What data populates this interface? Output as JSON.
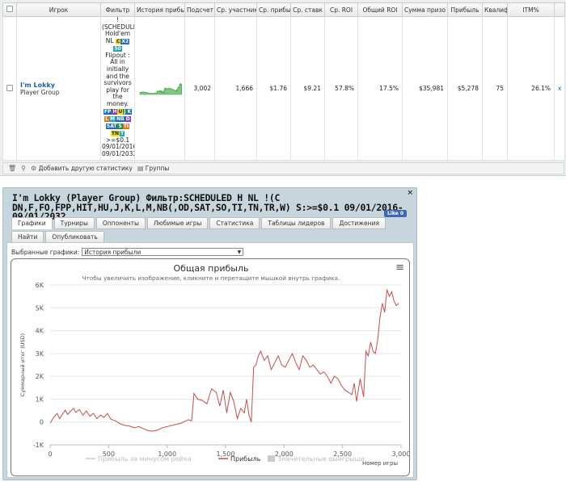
{
  "stats_table": {
    "headers": [
      "",
      "Игрок",
      "Фильтр",
      "История прибы",
      "Подсчет",
      "Ср. участник",
      "Ср. прибы",
      "Ср. ставк",
      "Ср. ROI",
      "Общий ROI",
      "Сумма призо",
      "Прибыль",
      "Квалиф",
      "ITM%",
      ""
    ],
    "row": {
      "player_name": "I'm Lokky",
      "player_group": "Player Group",
      "filter_lines_top": [
        "!",
        "(SCHEDULE",
        "Hold'em",
        "NL"
      ],
      "filter_tags1": [
        "C",
        "X2"
      ],
      "filter_tag_50": "50",
      "filter_desc": "Flipout : All in initially and the survivors play for the money.",
      "filter_tags2": [
        "FP",
        "H",
        "U",
        "J",
        "K",
        "L",
        "M",
        "NB",
        "D",
        "SAT",
        "S",
        "TI",
        "TN",
        "T"
      ],
      "filter_tail": [
        ">=$0.1",
        "09/01/2016",
        "09/01/2032"
      ],
      "count": "3,002",
      "avg_entrants": "1,666",
      "avg_profit": "$1.76",
      "avg_stake": "$9.21",
      "avg_roi": "57.8%",
      "total_roi": "17.5%",
      "prize_sum": "$35,981",
      "profit": "$5,278",
      "qualified": "75",
      "itm": "26.1%",
      "remove_link": "x"
    },
    "toolbar": {
      "add_stats": "Добавить другую статистику",
      "groups": "Группы"
    }
  },
  "panel": {
    "title": "I'm Lokky (Player Group) Фильтр:SCHEDULED H NL !(C DN,F,FO,FPP,HIT,HU,J,K,L,M,NB(,OD,SAT,SO,TI,TN,TR,W) S:>=$0.1 09/01/2016-09/01/2032",
    "like_label": "Like 0",
    "close": "×",
    "tabs": [
      "Графики",
      "Турниры",
      "Оппоненты",
      "Любимые игры",
      "Статистика",
      "Таблицы лидеров",
      "Достижения",
      "Найти",
      "Опубликовать"
    ],
    "active_tab": "Графики",
    "selected_label": "Выбранные графики:",
    "selected_value": "История прибыли"
  },
  "chart_data": {
    "type": "line",
    "title": "Общая прибыль",
    "subtitle": "Чтобы увеличить изображение, кликните и перетащите мышкой внутрь графика.",
    "ylabel": "Суммарный итог (USD)",
    "xlabel": "Номер игры",
    "xlim": [
      0,
      3000
    ],
    "ylim": [
      -1000,
      6000
    ],
    "x_ticks": [
      "0",
      "500",
      "1,000",
      "1,500",
      "2,000",
      "2,500",
      "3,000"
    ],
    "y_ticks": [
      "-1K",
      "0",
      "1K",
      "2K",
      "3K",
      "4K",
      "5K",
      "6K"
    ],
    "grid": true,
    "legend": [
      "Прибыль за минусом рейка",
      "Прибыль",
      "Значительные выигрыши"
    ],
    "legend_position": "bottom",
    "series": [
      {
        "name": "Прибыль",
        "color": "#c0504d",
        "x": [
          0,
          30,
          60,
          80,
          100,
          130,
          150,
          170,
          200,
          220,
          250,
          280,
          310,
          340,
          370,
          400,
          430,
          460,
          490,
          520,
          560,
          600,
          640,
          680,
          720,
          760,
          800,
          840,
          880,
          920,
          960,
          1000,
          1040,
          1080,
          1120,
          1150,
          1180,
          1210,
          1230,
          1260,
          1300,
          1340,
          1380,
          1420,
          1450,
          1480,
          1510,
          1540,
          1570,
          1600,
          1630,
          1660,
          1680,
          1700,
          1720,
          1740,
          1760,
          1780,
          1800,
          1830,
          1860,
          1890,
          1920,
          1950,
          1980,
          2010,
          2040,
          2070,
          2100,
          2130,
          2160,
          2190,
          2220,
          2250,
          2280,
          2310,
          2340,
          2370,
          2400,
          2430,
          2460,
          2490,
          2520,
          2550,
          2580,
          2600,
          2620,
          2650,
          2680,
          2700,
          2720,
          2740,
          2760,
          2780,
          2800,
          2820,
          2840,
          2860,
          2880,
          2900,
          2920,
          2940,
          2960,
          2980
        ],
        "y": [
          -50,
          200,
          380,
          150,
          300,
          520,
          330,
          450,
          600,
          420,
          550,
          300,
          480,
          250,
          380,
          150,
          300,
          200,
          380,
          120,
          50,
          -80,
          -150,
          -180,
          -250,
          -200,
          -300,
          -380,
          -400,
          -350,
          -250,
          -200,
          -150,
          -100,
          -50,
          30,
          100,
          50,
          1250,
          1000,
          950,
          800,
          1450,
          1300,
          700,
          1400,
          400,
          1300,
          900,
          150,
          600,
          400,
          1000,
          300,
          0,
          2400,
          2500,
          2900,
          3100,
          2700,
          2900,
          2300,
          2600,
          2900,
          2500,
          2400,
          2700,
          3000,
          2600,
          2300,
          2900,
          2700,
          2400,
          2500,
          2300,
          2100,
          2200,
          2000,
          1700,
          2000,
          1900,
          1600,
          1400,
          1300,
          1200,
          1700,
          900,
          1900,
          1100,
          3100,
          2900,
          3500,
          3100,
          3000,
          3600,
          4600,
          5200,
          4800,
          5800,
          5500,
          5700,
          5300,
          5100,
          5200
        ]
      }
    ]
  }
}
